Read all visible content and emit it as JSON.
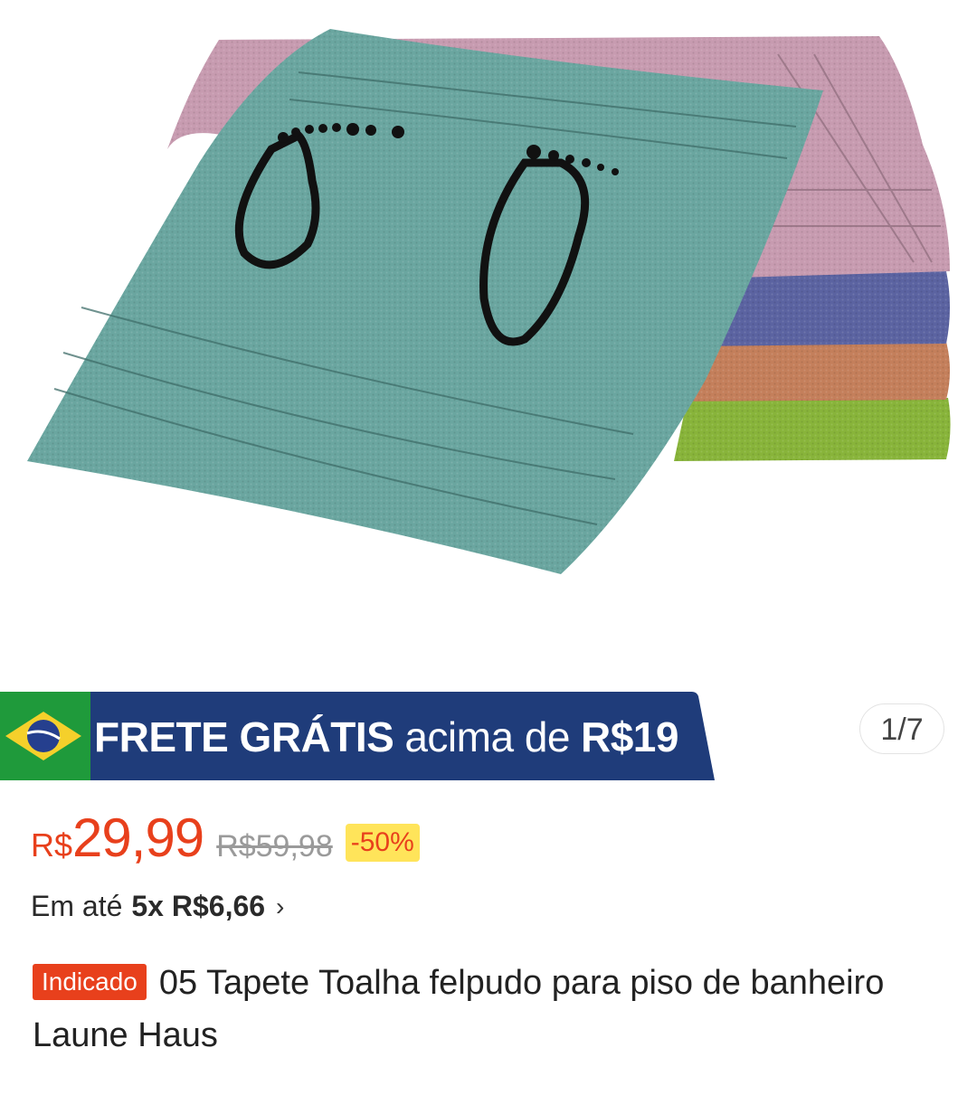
{
  "product_image": {
    "description_icon": "bath-mat-image",
    "colors": [
      "#6aa6a0",
      "#c79bb0",
      "#5b63a1",
      "#c47f5b",
      "#88b43a"
    ]
  },
  "promo_banner": {
    "flag_icon": "brazil-flag-icon",
    "strong_text": "FRETE GRÁTIS",
    "normal_text": "acima de",
    "amount_text": "R$19",
    "background_color": "#1f3c7a"
  },
  "image_counter": {
    "text": "1/7"
  },
  "price": {
    "currency": "R$",
    "value": "29,99",
    "old_price": "R$59,98",
    "discount": "-50%",
    "accent_color": "#e8401c"
  },
  "installments": {
    "prefix": "Em até",
    "value": "5x R$6,66",
    "chevron_icon": "chevron-right-icon"
  },
  "title": {
    "tag": "Indicado",
    "text": "05 Tapete Toalha felpudo para piso de banheiro Laune Haus"
  }
}
